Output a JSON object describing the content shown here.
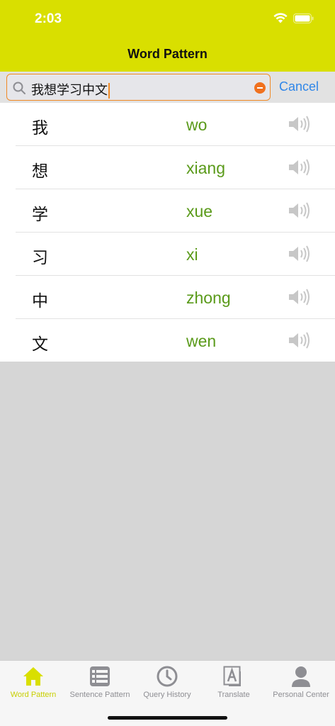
{
  "status_bar": {
    "time": "2:03"
  },
  "nav": {
    "title": "Word Pattern"
  },
  "search": {
    "value": "我想学习中文",
    "cancel_label": "Cancel"
  },
  "results": [
    {
      "char": "我",
      "pinyin": "wo"
    },
    {
      "char": "想",
      "pinyin": "xiang"
    },
    {
      "char": "学",
      "pinyin": "xue"
    },
    {
      "char": "习",
      "pinyin": "xi"
    },
    {
      "char": "中",
      "pinyin": "zhong"
    },
    {
      "char": "文",
      "pinyin": "wen"
    }
  ],
  "tabbar": {
    "tabs": [
      {
        "label": "Word Pattern",
        "icon": "home-icon",
        "active": true
      },
      {
        "label": "Sentence Pattern",
        "icon": "list-icon",
        "active": false
      },
      {
        "label": "Query History",
        "icon": "clock-icon",
        "active": false
      },
      {
        "label": "Translate",
        "icon": "translate-icon",
        "active": false
      },
      {
        "label": "Personal Center",
        "icon": "person-icon",
        "active": false
      }
    ]
  },
  "colors": {
    "accent": "#d9df00",
    "pinyin": "#5a9a1a",
    "link": "#2f86e8",
    "focus": "#f08a24"
  }
}
